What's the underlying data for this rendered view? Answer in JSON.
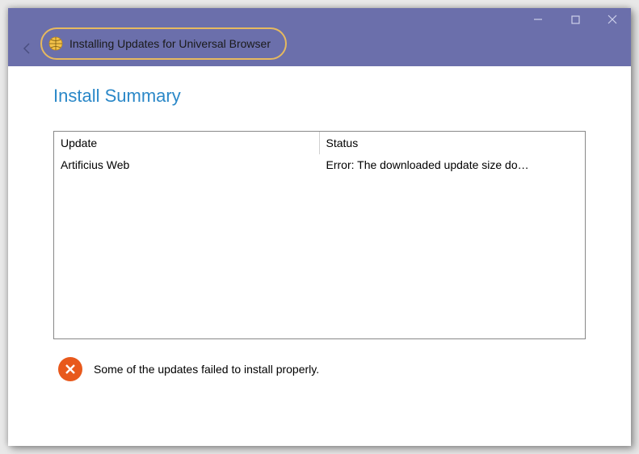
{
  "window": {
    "title": "Installing Updates for Universal Browser"
  },
  "page": {
    "heading": "Install Summary"
  },
  "table": {
    "columns": {
      "update": "Update",
      "status": "Status"
    },
    "rows": [
      {
        "update": "Artificius Web",
        "status": "Error: The downloaded update size do…"
      }
    ]
  },
  "footer": {
    "message": "Some of the updates failed to install properly."
  }
}
